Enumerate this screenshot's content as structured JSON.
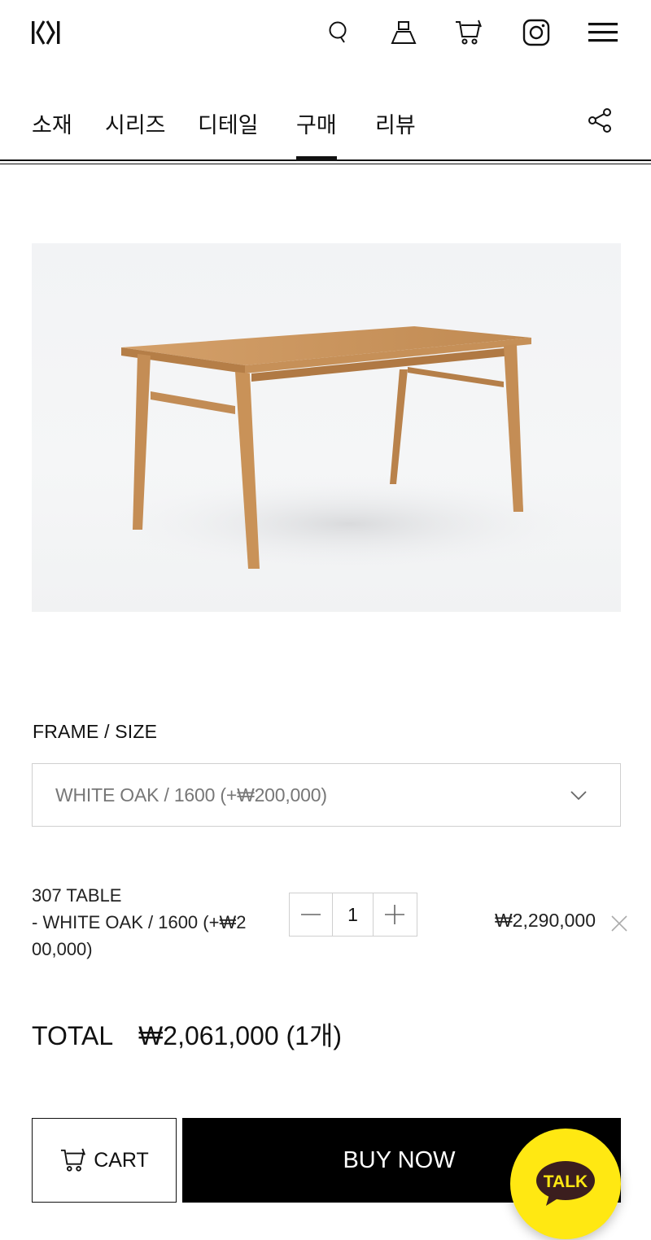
{
  "brand": {
    "logo_text": "KM"
  },
  "header": {
    "icons": [
      "search-icon",
      "user-icon",
      "cart-icon",
      "instagram-icon",
      "menu-icon"
    ]
  },
  "tabs": [
    {
      "label": "소재",
      "active": false
    },
    {
      "label": "시리즈",
      "active": false
    },
    {
      "label": "디테일",
      "active": false
    },
    {
      "label": "구매",
      "active": true
    },
    {
      "label": "리뷰",
      "active": false
    }
  ],
  "option": {
    "label": "FRAME / SIZE",
    "selected": "WHITE OAK / 1600 (+₩200,000)"
  },
  "line_item": {
    "name_line1": "307 TABLE",
    "name_line2": "- WHITE OAK / 1600 (+₩2",
    "name_line3": "00,000)",
    "quantity": "1",
    "price": "₩2,290,000"
  },
  "total": {
    "label": "TOTAL",
    "value": "₩2,061,000 (1개)"
  },
  "actions": {
    "cart_label": "CART",
    "buy_label": "BUY NOW"
  },
  "chat": {
    "label": "TALK"
  },
  "colors": {
    "accent": "#000000",
    "kakao": "#ffe812",
    "kakao_text": "#3b1e1e",
    "wood": "#c9955e"
  }
}
